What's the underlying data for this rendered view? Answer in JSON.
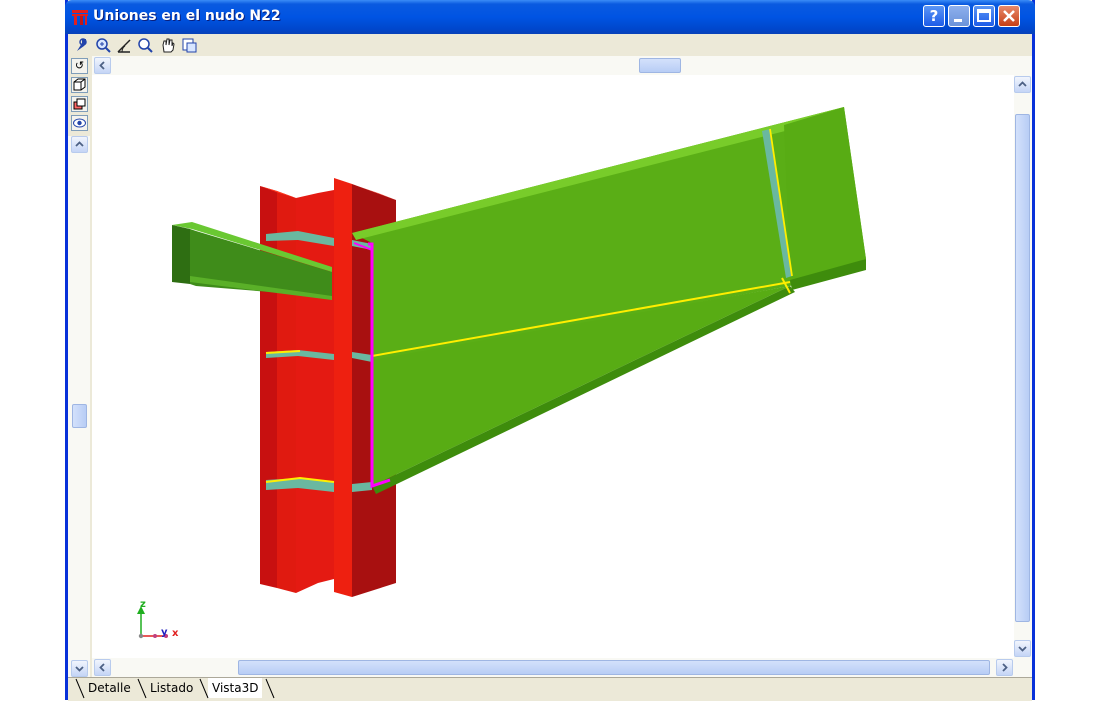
{
  "window": {
    "title": "Uniones en el nudo N22",
    "help_icon": "?"
  },
  "toolbar": {
    "icons": [
      "select-icon",
      "zoom-window-icon",
      "measure-icon",
      "zoom-icon",
      "pan-hand-icon",
      "copy-view-icon"
    ]
  },
  "left_toolbar": {
    "icons": [
      "rotate-icon",
      "box-view-icon",
      "stack-view-icon",
      "eye-view-icon"
    ]
  },
  "axes": {
    "z": "z",
    "y": "y",
    "x": "x"
  },
  "tabs": [
    {
      "label": "Detalle"
    },
    {
      "label": "Listado"
    },
    {
      "label": "Vista3D"
    }
  ],
  "colors": {
    "column": "#e01010",
    "rafter": "#5aae16",
    "secondary_beam": "#3f8c1a",
    "stiffener": "#6ab8a0",
    "weld": "#ffee00",
    "endplate": "#ff00ff",
    "titlebar": "#0054e3"
  }
}
